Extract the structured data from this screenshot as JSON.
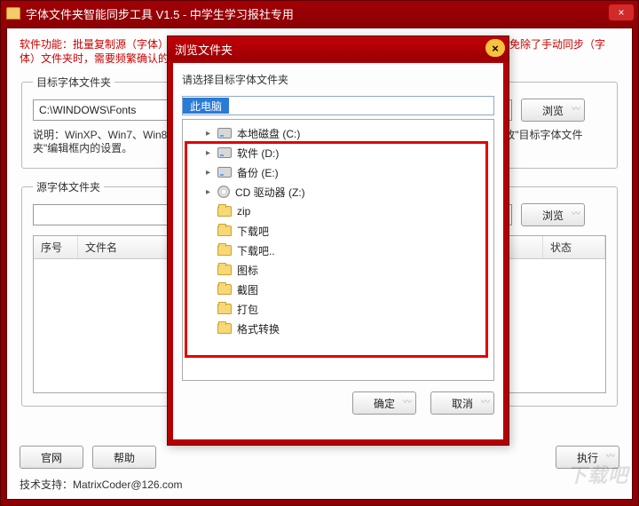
{
  "main": {
    "title": "字体文件夹智能同步工具 V1.5 - 中学生学习报社专用",
    "close": "×",
    "desc_line": "软件功能：批量复制源（字体）文件夹内的文件到目标（字体）文件夹，只复制目标文件夹没有的文件。免除了手动同步（字体）文件夹时，需要频繁确认的麻烦。",
    "group_target": "目标字体文件夹",
    "target_path": "C:\\WINDOWS\\Fonts",
    "browse": "浏览",
    "target_hint": "说明：WinXP、Win7、Win8、Win10系统默认都是\"C:\\WINDOWS\\Fonts\"，如果该文件夹不对，请修改\"目标字体文件夹\"编辑框内的设置。",
    "group_source": "源字体文件夹",
    "col_index": "序号",
    "col_name": "文件名",
    "col_status": "状态",
    "btn_site": "官网",
    "btn_help": "帮助",
    "btn_run": "执行",
    "support": "技术支持：MatrixCoder@126.com"
  },
  "dialog": {
    "title": "浏览文件夹",
    "close": "×",
    "instr": "请选择目标字体文件夹",
    "path_label": "此电脑",
    "ok": "确定",
    "cancel": "取消",
    "items": [
      {
        "label": "本地磁盘 (C:)",
        "kind": "drive",
        "expand": true
      },
      {
        "label": "软件 (D:)",
        "kind": "drive",
        "expand": true
      },
      {
        "label": "备份 (E:)",
        "kind": "drive",
        "expand": true
      },
      {
        "label": "CD 驱动器 (Z:)",
        "kind": "cd",
        "expand": true
      },
      {
        "label": "zip",
        "kind": "folder",
        "expand": false
      },
      {
        "label": "下载吧",
        "kind": "folder",
        "expand": false
      },
      {
        "label": "下载吧..",
        "kind": "folder",
        "expand": false
      },
      {
        "label": "图标",
        "kind": "folder",
        "expand": false
      },
      {
        "label": "截图",
        "kind": "folder",
        "expand": false
      },
      {
        "label": "打包",
        "kind": "folder",
        "expand": false
      },
      {
        "label": "格式转换",
        "kind": "folder",
        "expand": false
      }
    ]
  },
  "watermark": "下载吧"
}
